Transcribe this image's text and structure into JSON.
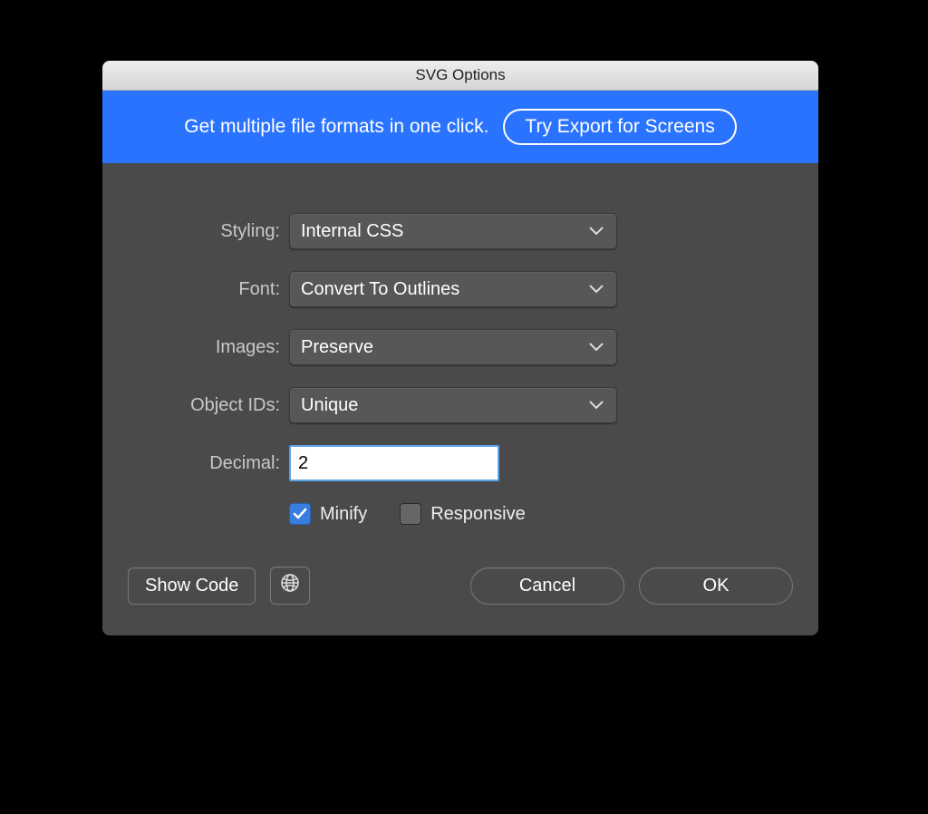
{
  "window": {
    "title": "SVG Options"
  },
  "banner": {
    "text": "Get multiple file formats in one click.",
    "cta": "Try Export for Screens"
  },
  "form": {
    "styling": {
      "label": "Styling:",
      "value": "Internal CSS"
    },
    "font": {
      "label": "Font:",
      "value": "Convert To Outlines"
    },
    "images": {
      "label": "Images:",
      "value": "Preserve"
    },
    "objectids": {
      "label": "Object IDs:",
      "value": "Unique"
    },
    "decimal": {
      "label": "Decimal:",
      "value": "2"
    },
    "minify": {
      "label": "Minify",
      "checked": true
    },
    "responsive": {
      "label": "Responsive",
      "checked": false
    }
  },
  "footer": {
    "showcode": "Show Code",
    "cancel": "Cancel",
    "ok": "OK"
  }
}
